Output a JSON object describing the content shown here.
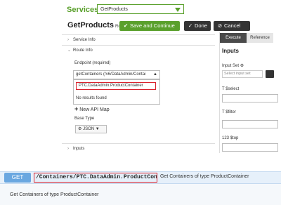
{
  "header": {
    "services_label": "Services",
    "services_value": "GetProducts",
    "title": "GetProducts",
    "title_suffix": "Route",
    "buttons": {
      "save_continue": "Save and Continue",
      "done": "Done",
      "cancel": "Cancel"
    }
  },
  "left": {
    "service_info": "Service Info",
    "route_info": "Route Info",
    "endpoint_label": "Endpoint",
    "endpoint_required": "(required)",
    "endpoint_value": "getContainers (/v6/DataAdmin/Contai",
    "dropdown_option": "PTC.DataAdmin.ProductContainer",
    "no_results": "No results found",
    "new_api_map": "New API Map",
    "base_type_label": "Base Type",
    "base_type_value": "JSON",
    "inputs_row": "Inputs"
  },
  "right": {
    "tabs": [
      "Execute",
      "Reference"
    ],
    "inputs_heading": "Inputs",
    "input_set_label": "Input Set",
    "input_set_placeholder": "Select input set",
    "params": [
      "$select",
      "$filter",
      "$top"
    ]
  },
  "doc": {
    "method": "GET",
    "path": "/Containers/PTC.DataAdmin.ProductContainer",
    "summary": "Get Containers of type ProductContainer",
    "description": "Get Containers of type ProductContainer"
  }
}
